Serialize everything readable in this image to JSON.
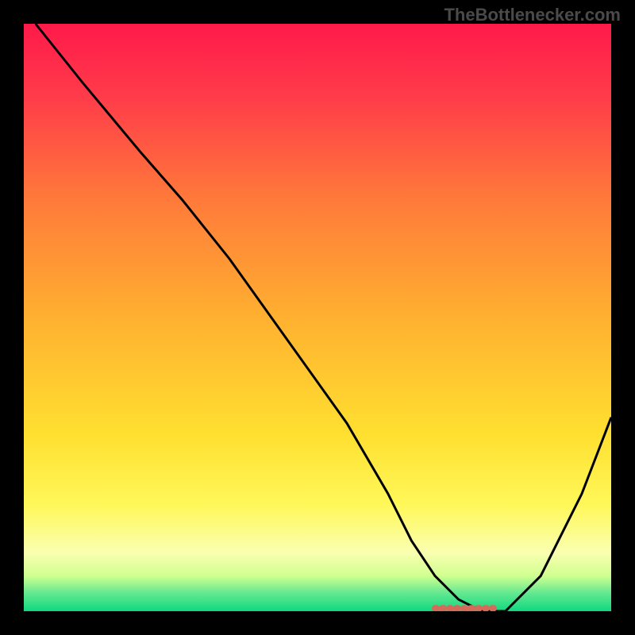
{
  "watermark": "TheBottlenecker.com",
  "chart_data": {
    "type": "line",
    "title": "",
    "xlabel": "",
    "ylabel": "",
    "xlim": [
      0,
      100
    ],
    "ylim": [
      0,
      100
    ],
    "gradient_stops": [
      {
        "offset": 0,
        "color": "#ff1a4a"
      },
      {
        "offset": 12,
        "color": "#ff3a4a"
      },
      {
        "offset": 30,
        "color": "#ff7a3a"
      },
      {
        "offset": 50,
        "color": "#ffb030"
      },
      {
        "offset": 70,
        "color": "#ffe030"
      },
      {
        "offset": 82,
        "color": "#fff85a"
      },
      {
        "offset": 90,
        "color": "#faffb0"
      },
      {
        "offset": 94,
        "color": "#d0ff90"
      },
      {
        "offset": 97,
        "color": "#60e890"
      },
      {
        "offset": 100,
        "color": "#10d880"
      }
    ],
    "series": [
      {
        "name": "bottleneck-curve",
        "color": "#000000",
        "x": [
          2,
          10,
          20,
          27,
          35,
          45,
          55,
          62,
          66,
          70,
          74,
          78,
          82,
          88,
          95,
          100
        ],
        "values": [
          100,
          90,
          78,
          70,
          60,
          46,
          32,
          20,
          12,
          6,
          2,
          0,
          0,
          6,
          20,
          33
        ]
      }
    ],
    "marker": {
      "name": "optimal-segment",
      "color": "#d46a5a",
      "x_start": 70,
      "x_end": 80,
      "y": 0.5
    }
  }
}
